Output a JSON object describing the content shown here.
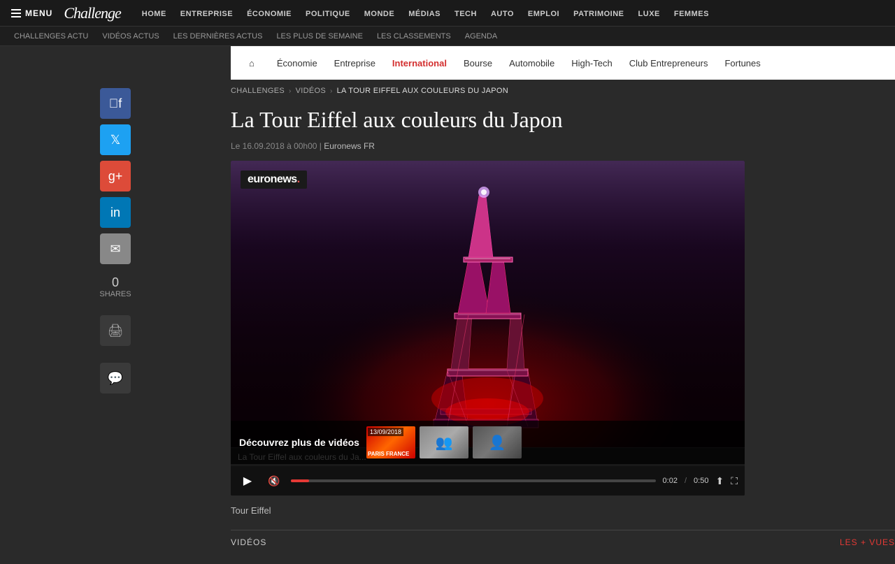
{
  "topNav": {
    "menuLabel": "MENU",
    "logoText": "Challenge",
    "items": [
      {
        "label": "HOME",
        "id": "home"
      },
      {
        "label": "ENTREPRISE",
        "id": "entreprise"
      },
      {
        "label": "ÉCONOMIE",
        "id": "economie"
      },
      {
        "label": "POLITIQUE",
        "id": "politique"
      },
      {
        "label": "MONDE",
        "id": "monde"
      },
      {
        "label": "MÉDIAS",
        "id": "medias"
      },
      {
        "label": "TECH",
        "id": "tech"
      },
      {
        "label": "AUTO",
        "id": "auto"
      },
      {
        "label": "EMPLOI",
        "id": "emploi"
      },
      {
        "label": "PATRIMOINE",
        "id": "patrimoine"
      },
      {
        "label": "LUXE",
        "id": "luxe"
      },
      {
        "label": "FEMMES",
        "id": "femmes"
      }
    ]
  },
  "subNav": {
    "items": [
      "CHALLENGES ACTU",
      "VIDÉOS ACTUS",
      "LES DERNIÈRES ACTUS",
      "LES PLUS DE SEMAINE",
      "LES CLASSEMENTS",
      "AGENDA"
    ]
  },
  "categoryNav": {
    "homeIcon": "⌂",
    "items": [
      {
        "label": "Économie",
        "id": "economie",
        "active": false
      },
      {
        "label": "Entreprise",
        "id": "entreprise",
        "active": false
      },
      {
        "label": "International",
        "id": "international",
        "active": true
      },
      {
        "label": "Bourse",
        "id": "bourse",
        "active": false
      },
      {
        "label": "Automobile",
        "id": "automobile",
        "active": false
      },
      {
        "label": "High-Tech",
        "id": "hightech",
        "active": false
      },
      {
        "label": "Club Entrepreneurs",
        "id": "club",
        "active": false
      },
      {
        "label": "Fortunes",
        "id": "fortunes",
        "active": false
      }
    ]
  },
  "breadcrumb": {
    "challenges": "CHALLENGES",
    "videos": "VIDÉOS",
    "current": "LA TOUR EIFFEL AUX COULEURS DU JAPON"
  },
  "article": {
    "title": "La Tour Eiffel aux couleurs du Japon",
    "meta": "Le 16.09.2018 à 00h00 | Euronews FR",
    "source": "Euronews FR"
  },
  "video": {
    "euronewsLogo": "euronews.",
    "overlayText": "Découvrez plus de vidéos",
    "titleBar": "La Tour Eiffel aux couleurs du Ja...",
    "thumbDate": "13/09/2018",
    "thumbLocation": "PARIS FRANCE",
    "currentTime": "0:02",
    "totalTime": "0:50"
  },
  "social": {
    "sharesNum": "0",
    "sharesLabel": "SHARES"
  },
  "footer": {
    "videosLabel": "VIDÉOS",
    "lesPlusVues": "LES + VUES"
  },
  "articleTag": "Tour Eiffel"
}
